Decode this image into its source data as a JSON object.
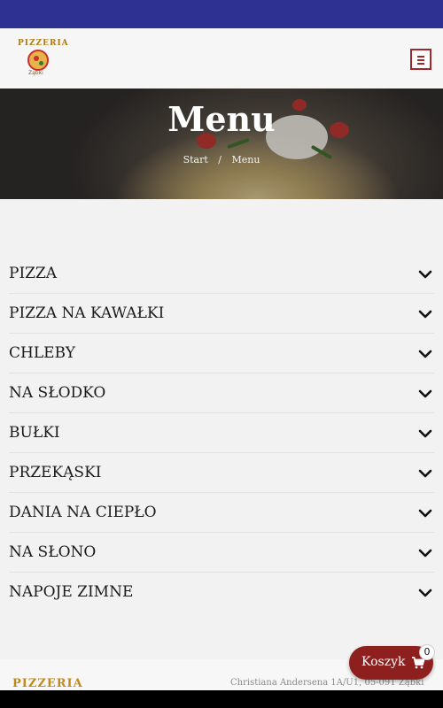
{
  "header": {
    "logo_alt": "Pizzeria Ząbki",
    "logo_word": "PIZZERIA",
    "logo_town": "Ząbki",
    "menu_icon": "hamburger-menu-icon"
  },
  "hero": {
    "title": "Menu",
    "breadcrumb": {
      "home": "Start",
      "separator": "/",
      "current": "Menu"
    }
  },
  "menu_categories": [
    {
      "label": "PIZZA",
      "icon": "chevron-down-icon"
    },
    {
      "label": "PIZZA NA KAWAŁKI",
      "icon": "chevron-down-icon"
    },
    {
      "label": "CHLEBY",
      "icon": "chevron-down-icon"
    },
    {
      "label": "NA SŁODKO",
      "icon": "chevron-down-icon"
    },
    {
      "label": "BUŁKI",
      "icon": "chevron-down-icon"
    },
    {
      "label": "PRZEKĄSKI",
      "icon": "chevron-down-icon"
    },
    {
      "label": "DANIA NA CIEPŁO",
      "icon": "chevron-down-icon"
    },
    {
      "label": "NA SŁONO",
      "icon": "chevron-down-icon"
    },
    {
      "label": "NAPOJE ZIMNE",
      "icon": "chevron-down-icon"
    }
  ],
  "footer": {
    "logo_text": "PIZZERIA",
    "address": "Christiana Andersena 1A/U1, 05-091 Ząbki"
  },
  "cart": {
    "label": "Koszyk",
    "count": "0",
    "icon": "shopping-cart-icon"
  },
  "colors": {
    "topbar": "#2e3192",
    "accent": "#8e1f1f",
    "text": "#1b1b1b"
  }
}
